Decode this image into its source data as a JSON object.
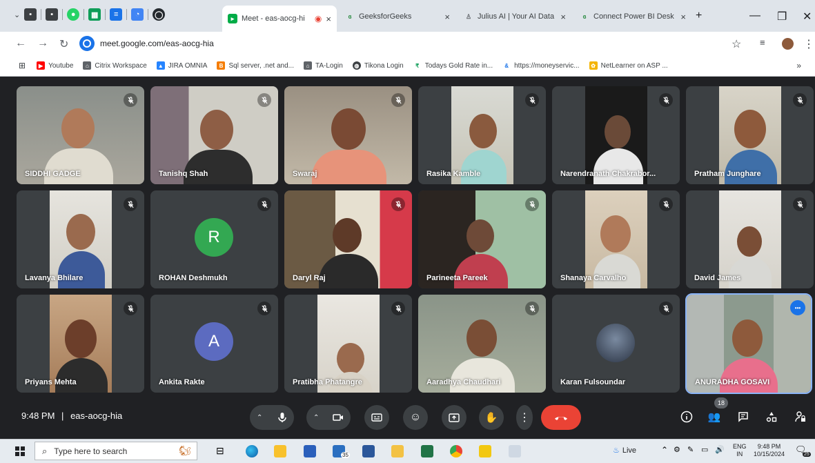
{
  "browser": {
    "tabs": [
      {
        "title": "Meet - eas-aocg-hi",
        "active": true
      },
      {
        "title": "GeeksforGeeks",
        "active": false
      },
      {
        "title": "Julius AI | Your AI Data",
        "active": false
      },
      {
        "title": "Connect Power BI Desk",
        "active": false
      }
    ],
    "url": "meet.google.com/eas-aocg-hia",
    "bookmarks": [
      "Youtube",
      "Citrix Workspace",
      "JIRA OMNIA",
      "Sql server, .net and...",
      "TA-Login",
      "Tikona Login",
      "Todays Gold Rate in...",
      "https://moneyservic...",
      "NetLearner on ASP ..."
    ],
    "bookmarks_more": "»"
  },
  "meet": {
    "participants": [
      {
        "name": "SIDDHI GADGE",
        "type": "video"
      },
      {
        "name": "Tanishq Shah",
        "type": "video"
      },
      {
        "name": "Swaraj",
        "type": "video"
      },
      {
        "name": "Rasika Kamble",
        "type": "video"
      },
      {
        "name": "Narendranath Chakrabor...",
        "type": "video"
      },
      {
        "name": "Pratham Junghare",
        "type": "video"
      },
      {
        "name": "Lavanya Bhilare",
        "type": "video"
      },
      {
        "name": "ROHAN Deshmukh",
        "type": "avatar",
        "initial": "R",
        "color": "#33a852"
      },
      {
        "name": "Daryl Raj",
        "type": "video"
      },
      {
        "name": "Parineeta Pareek",
        "type": "video"
      },
      {
        "name": "Shanaya Carvalho",
        "type": "video"
      },
      {
        "name": "David James",
        "type": "video"
      },
      {
        "name": "Priyans Mehta",
        "type": "video"
      },
      {
        "name": "Ankita Rakte",
        "type": "avatar",
        "initial": "A",
        "color": "#5c6bc0"
      },
      {
        "name": "Pratibha Phatangre",
        "type": "video"
      },
      {
        "name": "Aaradhya Chaudhari",
        "type": "video"
      },
      {
        "name": "Karan Fulsoundar",
        "type": "video"
      },
      {
        "name": "ANURADHA GOSAVI",
        "type": "video",
        "active": true
      }
    ],
    "time": "9:48 PM",
    "separator": "|",
    "meeting_code": "eas-aocg-hia",
    "participant_count": "18",
    "more_options": "•••"
  },
  "taskbar": {
    "search_placeholder": "Type here to search",
    "weather": "Live",
    "lang_top": "ENG",
    "lang_bottom": "IN",
    "clock_time": "9:48 PM",
    "clock_date": "10/15/2024",
    "mail_count": "35",
    "notif_count": "25"
  },
  "colors": {
    "meet_bg": "#202124",
    "tile_bg": "#3c4043",
    "end_call": "#ea4335",
    "accent": "#1a73e8"
  }
}
